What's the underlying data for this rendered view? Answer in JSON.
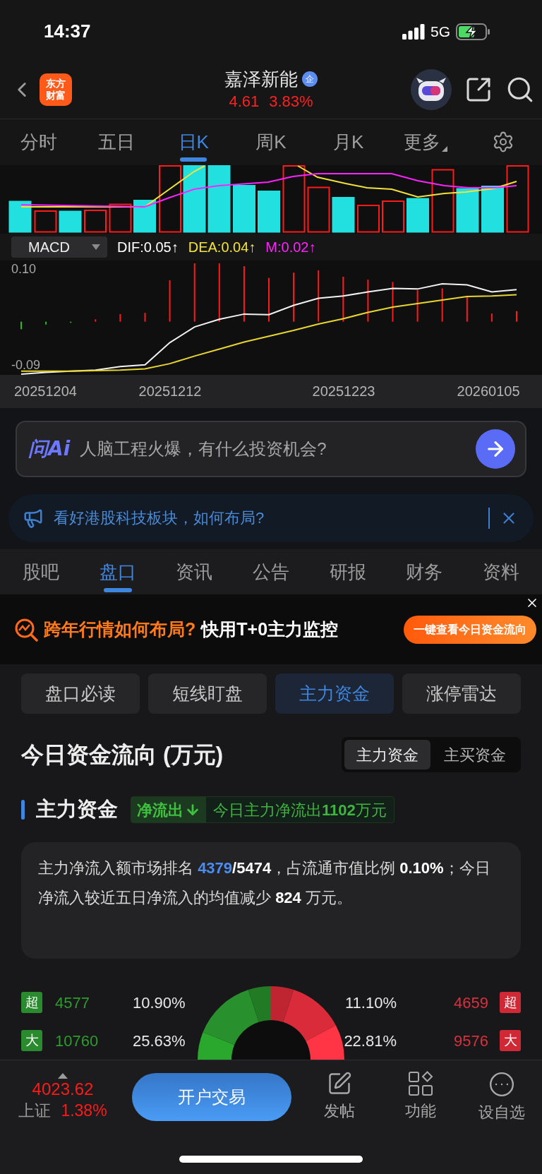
{
  "status_bar": {
    "time": "14:37",
    "network": "5G"
  },
  "header": {
    "logo": [
      "东方",
      "财富"
    ],
    "title": "嘉泽新能",
    "badge": "企",
    "price": "4.61",
    "change": "3.83%"
  },
  "period_tabs": [
    {
      "label": "分时",
      "selected": false,
      "kind": "tab"
    },
    {
      "label": "五日",
      "selected": false,
      "kind": "tab"
    },
    {
      "label": "日K",
      "selected": true,
      "kind": "tab"
    },
    {
      "label": "周K",
      "selected": false,
      "kind": "tab"
    },
    {
      "label": "月K",
      "selected": false,
      "kind": "tab"
    },
    {
      "label": "更多",
      "selected": false,
      "kind": "menu"
    }
  ],
  "macd": {
    "indicator": "MACD",
    "legend": [
      {
        "label": "DIF:0.05↑",
        "color": "#ffffff"
      },
      {
        "label": "DEA:0.04↑",
        "color": "#f2e33a"
      },
      {
        "label": "M:0.02↑",
        "color": "#ff22ff"
      }
    ],
    "y_labels": [
      "0.10",
      "-0.09"
    ],
    "x_labels": [
      "20251204",
      "20251212",
      "20251223",
      "20260105"
    ]
  },
  "ask_ai": {
    "logo": "问Ai",
    "placeholder": "人脑工程火爆，有什么投资机会?"
  },
  "notice": {
    "text": "看好港股科技板块，如何布局?"
  },
  "content_tabs": [
    {
      "label": "股吧",
      "selected": false
    },
    {
      "label": "盘口",
      "selected": true
    },
    {
      "label": "资讯",
      "selected": false
    },
    {
      "label": "公告",
      "selected": false
    },
    {
      "label": "研报",
      "selected": false
    },
    {
      "label": "财务",
      "selected": false
    },
    {
      "label": "资料",
      "selected": false
    }
  ],
  "promo": {
    "headline": "跨年行情如何布局?",
    "subline": "快用T+0主力监控",
    "button": "一键查看今日资金流向"
  },
  "sub_tabs": [
    {
      "label": "盘口必读",
      "selected": false
    },
    {
      "label": "短线盯盘",
      "selected": false
    },
    {
      "label": "主力资金",
      "selected": true
    },
    {
      "label": "涨停雷达",
      "selected": false
    }
  ],
  "flow": {
    "title": "今日资金流向 (万元)",
    "toggle": [
      {
        "label": "主力资金",
        "selected": true
      },
      {
        "label": "主买资金",
        "selected": false
      }
    ],
    "section_title": "主力资金",
    "direction": "净流出",
    "summary": "今日主力净流出**1102**万元",
    "note": [
      {
        "text": "主力净流入额市场排名 ",
        "kind": "plain"
      },
      {
        "text": "4379",
        "kind": "highlight"
      },
      {
        "text": "/5474",
        "kind": "bold"
      },
      {
        "text": "，占流通市值比例 ",
        "kind": "plain"
      },
      {
        "text": "0.10%",
        "kind": "bold"
      },
      {
        "text": "；今日净流入较近五日净流入的均值减少 ",
        "kind": "plain"
      },
      {
        "text": "824",
        "kind": "bold"
      },
      {
        "text": " 万元。",
        "kind": "plain"
      }
    ],
    "rows": [
      {
        "left_tag": "超",
        "out_amount": "4577",
        "out_share": "10.90%",
        "in_share": "11.10%",
        "in_amount": "4659",
        "right_tag": "超"
      },
      {
        "left_tag": "大",
        "out_amount": "10760",
        "out_share": "25.63%",
        "in_share": "22.81%",
        "in_amount": "9576",
        "right_tag": "大"
      }
    ]
  },
  "bottom_bar": {
    "index_value": "4023.62",
    "index_name": "上证",
    "index_change": "1.38%",
    "trade_button": "开户交易",
    "actions": [
      {
        "label": "发帖",
        "kind": "post"
      },
      {
        "label": "功能",
        "kind": "grid"
      },
      {
        "label": "设自选",
        "kind": "more"
      }
    ]
  }
}
